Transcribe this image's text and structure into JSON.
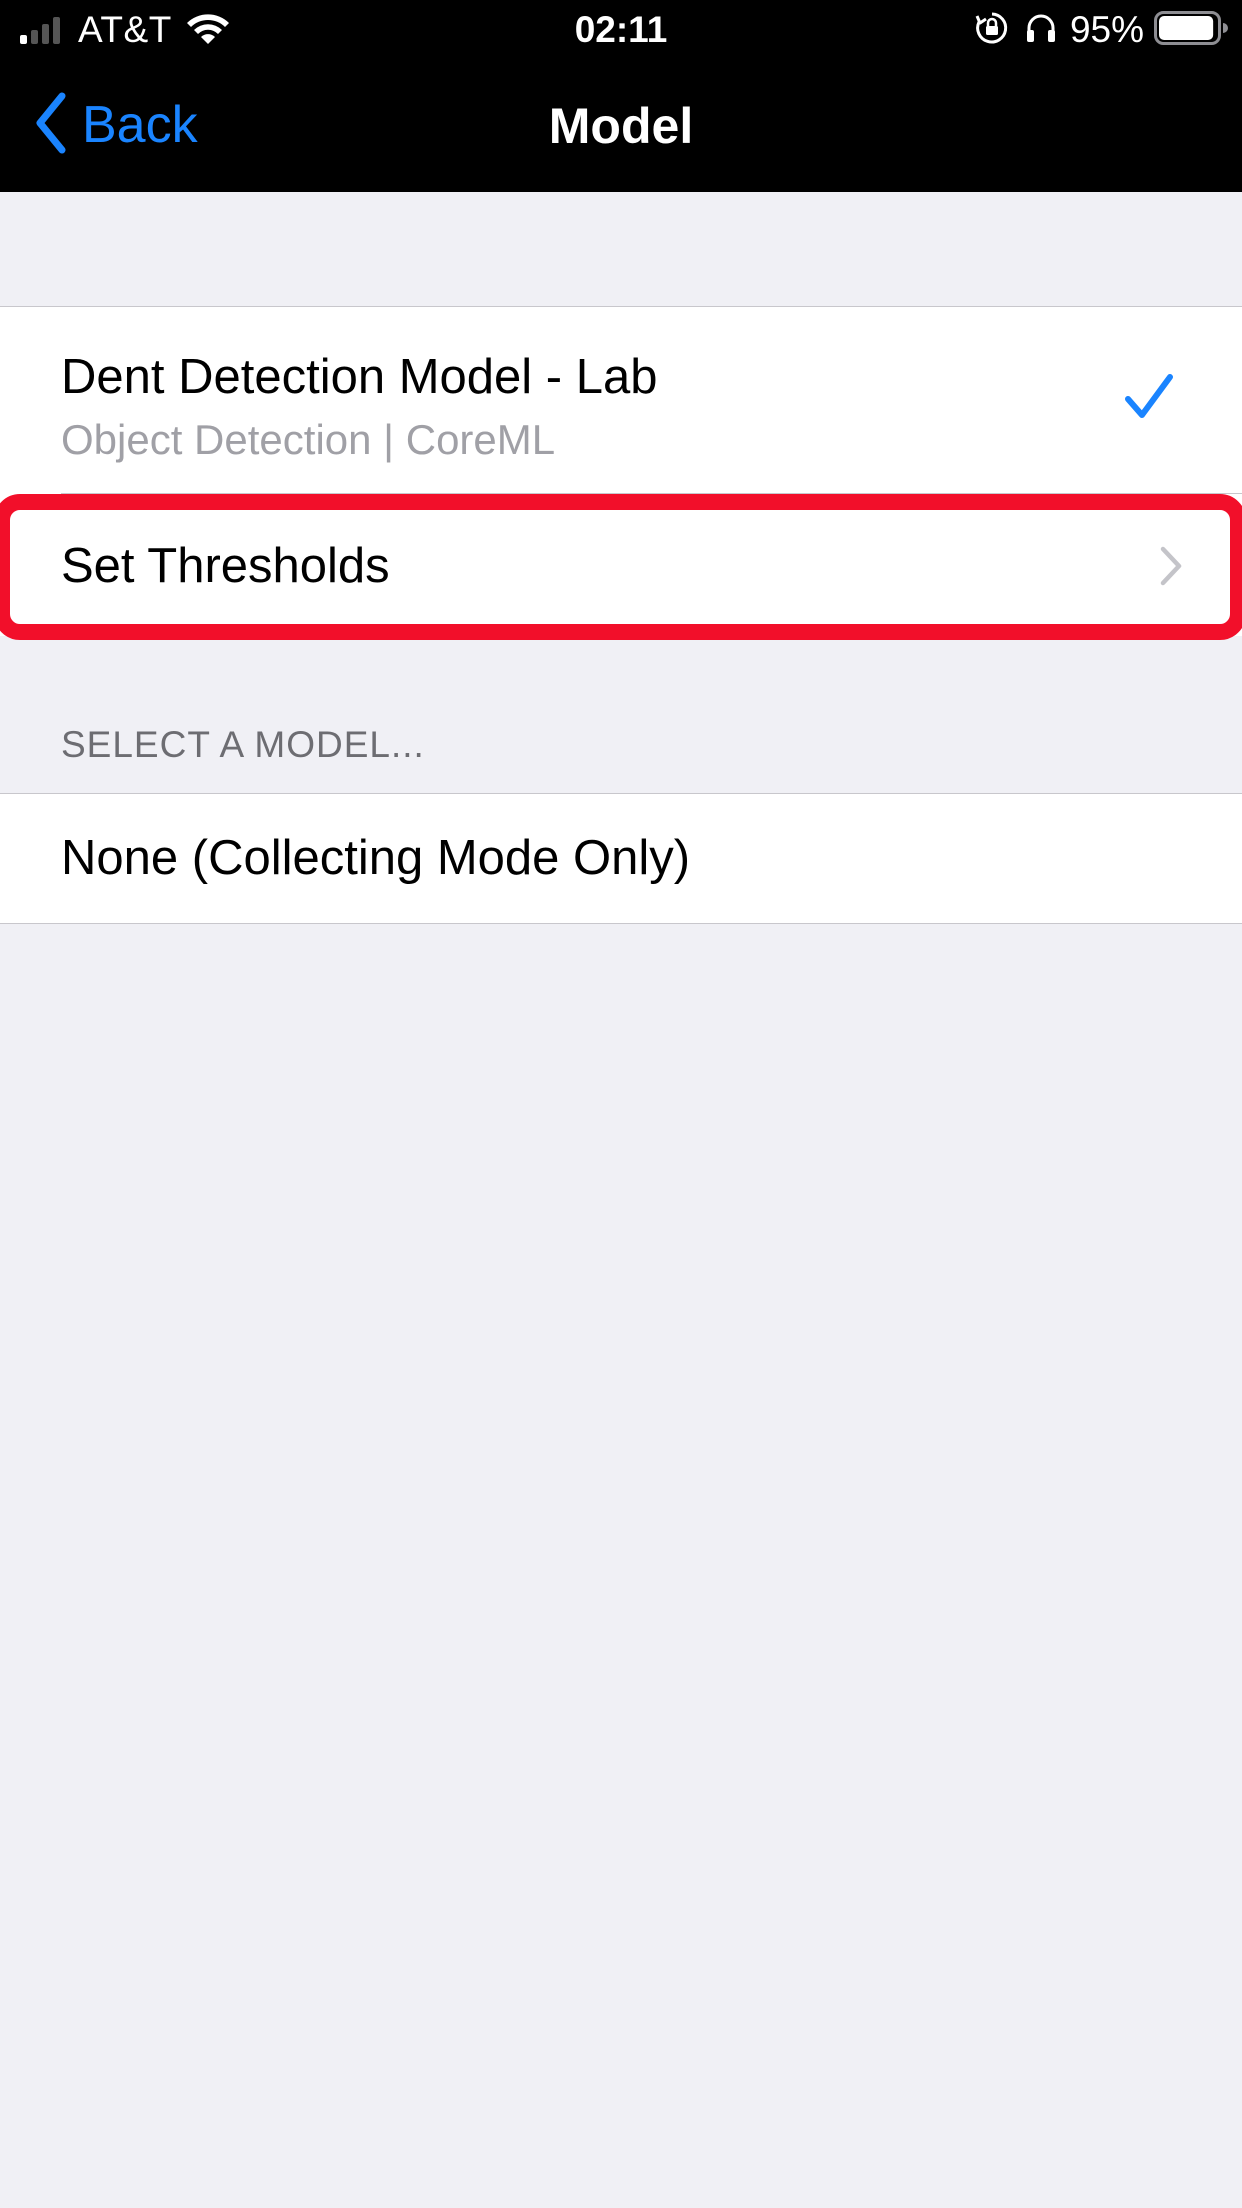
{
  "status_bar": {
    "carrier": "AT&T",
    "time": "02:11",
    "battery_percent": "95%",
    "battery_level": 0.95,
    "icons": [
      "cellular-signal-icon",
      "wifi-icon",
      "orientation-lock-icon",
      "headphones-icon",
      "battery-icon"
    ]
  },
  "nav": {
    "back_label": "Back",
    "title": "Model",
    "back_icon": "chevron-left-icon"
  },
  "current_model": {
    "name": "Dent Detection Model - Lab",
    "subtitle": "Object Detection | CoreML",
    "selected_icon": "checkmark-icon"
  },
  "thresholds": {
    "label": "Set Thresholds",
    "disclosure_icon": "chevron-right-icon"
  },
  "select_section": {
    "header": "SELECT A MODEL...",
    "options": [
      {
        "label": "None (Collecting Mode Only)"
      }
    ]
  },
  "colors": {
    "accent": "#1a84ff",
    "highlight": "#f20f2a",
    "background": "#f0f0f5",
    "secondary_text": "#a0a0a6"
  }
}
